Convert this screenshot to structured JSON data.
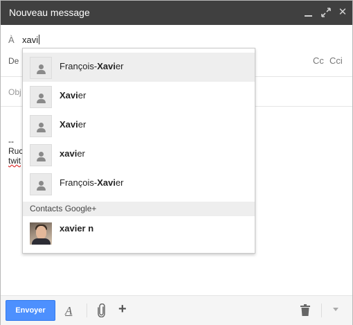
{
  "window": {
    "title": "Nouveau message",
    "titlebar_color": "#404040",
    "controls": [
      "minimize-icon",
      "expand-icon",
      "close-icon"
    ],
    "close_glyph": "✕"
  },
  "recipients": {
    "to_label": "À",
    "to_value": "xavi"
  },
  "from_row": {
    "label": "De",
    "cc_label": "Cc",
    "bcc_label": "Cci"
  },
  "subject": {
    "label": "Obj"
  },
  "body": {
    "line1": "--",
    "line2": "Ruc",
    "line3": "twit"
  },
  "suggestions": [
    {
      "pre": "François-",
      "match": "Xavi",
      "post": "er",
      "active": true
    },
    {
      "pre": "",
      "match": "Xavi",
      "post": "er",
      "active": false
    },
    {
      "pre": "",
      "match": "Xavi",
      "post": "er",
      "active": false
    },
    {
      "pre": "",
      "match": "xavi",
      "post": "er",
      "active": false
    },
    {
      "pre": "François-",
      "match": "Xavi",
      "post": "er",
      "active": false
    }
  ],
  "google_plus": {
    "section_label": "Contacts Google+",
    "contact": {
      "pre": "",
      "match": "xavi",
      "post": "er n"
    }
  },
  "footer": {
    "send_label": "Envoyer",
    "send_color": "#4d90fe",
    "icons": [
      "text-format-icon",
      "paperclip-icon",
      "plus-icon",
      "trash-icon",
      "more-options-icon"
    ],
    "plus_glyph": "+",
    "format_glyph": "A"
  }
}
